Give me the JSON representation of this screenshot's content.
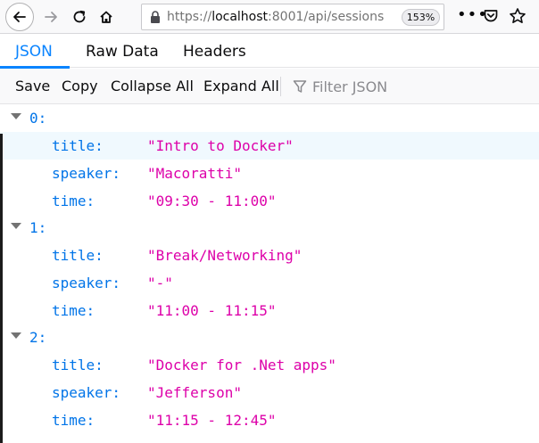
{
  "browser": {
    "url_prefix": "https://",
    "url_host": "localhost",
    "url_path": ":8001/api/sessions",
    "zoom": "153%"
  },
  "tabs": [
    {
      "label": "JSON",
      "active": true
    },
    {
      "label": "Raw Data",
      "active": false
    },
    {
      "label": "Headers",
      "active": false
    }
  ],
  "toolbar": {
    "save": "Save",
    "copy": "Copy",
    "collapse_all": "Collapse All",
    "expand_all": "Expand All",
    "filter_placeholder": "Filter JSON"
  },
  "sessions": [
    {
      "index": "0:",
      "fields": [
        {
          "key": "title:",
          "value": "\"Intro to Docker\""
        },
        {
          "key": "speaker:",
          "value": "\"Macoratti\""
        },
        {
          "key": "time:",
          "value": "\"09:30 - 11:00\""
        }
      ]
    },
    {
      "index": "1:",
      "fields": [
        {
          "key": "title:",
          "value": "\"Break/Networking\""
        },
        {
          "key": "speaker:",
          "value": "\"-\""
        },
        {
          "key": "time:",
          "value": "\"11:00 - 11:15\""
        }
      ]
    },
    {
      "index": "2:",
      "fields": [
        {
          "key": "title:",
          "value": "\"Docker for .Net apps\""
        },
        {
          "key": "speaker:",
          "value": "\"Jefferson\""
        },
        {
          "key": "time:",
          "value": "\"11:15 - 12:45\""
        }
      ]
    }
  ],
  "colors": {
    "accent": "#0a84ff",
    "key": "#0074e8",
    "string": "#dd00a9",
    "row_highlight": "#f0f9fe"
  }
}
